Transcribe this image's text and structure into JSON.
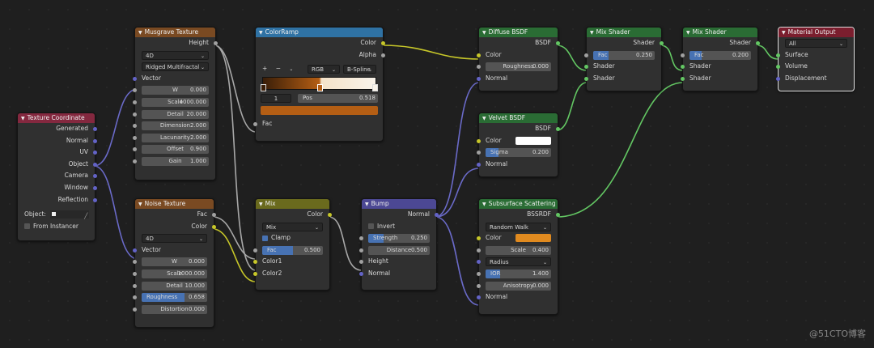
{
  "nodes": {
    "texcoord": {
      "title": "Texture Coordinate",
      "outputs": [
        "Generated",
        "Normal",
        "UV",
        "Object",
        "Camera",
        "Window",
        "Reflection"
      ],
      "object_label": "Object:",
      "from_instancer": "From Instancer"
    },
    "musgrave": {
      "title": "Musgrave Texture",
      "out_height": "Height",
      "dim": "4D",
      "type": "Ridged Multifractal",
      "in_vector": "Vector",
      "fields": [
        {
          "l": "W",
          "v": "0.000"
        },
        {
          "l": "Scale",
          "v": "4000.000"
        },
        {
          "l": "Detail",
          "v": "20.000"
        },
        {
          "l": "Dimension",
          "v": "2.000"
        },
        {
          "l": "Lacunarity",
          "v": "2.000"
        },
        {
          "l": "Offset",
          "v": "0.900"
        },
        {
          "l": "Gain",
          "v": "1.000"
        }
      ]
    },
    "noise": {
      "title": "Noise Texture",
      "out_fac": "Fac",
      "out_color": "Color",
      "dim": "4D",
      "in_vector": "Vector",
      "fields": [
        {
          "l": "W",
          "v": "0.000"
        },
        {
          "l": "Scale",
          "v": "1000.000"
        },
        {
          "l": "Detail",
          "v": "10.000"
        },
        {
          "l": "Roughness",
          "v": "0.658"
        },
        {
          "l": "Distortion",
          "v": "0.000"
        }
      ]
    },
    "colorramp": {
      "title": "ColorRamp",
      "out_color": "Color",
      "out_alpha": "Alpha",
      "plus": "+",
      "minus": "−",
      "mode": "RGB",
      "interp": "B-Spline",
      "index": "1",
      "pos_label": "Pos",
      "pos_value": "0.518",
      "in_fac": "Fac",
      "color": "#b45e14"
    },
    "mix": {
      "title": "Mix",
      "out_color": "Color",
      "blend": "Mix",
      "clamp": "Clamp",
      "fac_label": "Fac",
      "fac_value": "0.500",
      "in_c1": "Color1",
      "in_c2": "Color2"
    },
    "bump": {
      "title": "Bump",
      "out_normal": "Normal",
      "invert": "Invert",
      "strength_label": "Strength",
      "strength_value": "0.250",
      "distance_label": "Distance",
      "distance_value": "0.500",
      "in_height": "Height",
      "in_normal": "Normal"
    },
    "diffuse": {
      "title": "Diffuse BSDF",
      "out_bsdf": "BSDF",
      "in_color": "Color",
      "rough_label": "Roughness",
      "rough_value": "0.000",
      "in_normal": "Normal"
    },
    "velvet": {
      "title": "Velvet BSDF",
      "out_bsdf": "BSDF",
      "in_color": "Color",
      "sigma_label": "Sigma",
      "sigma_value": "0.200",
      "in_normal": "Normal",
      "color": "#ffffff"
    },
    "sss": {
      "title": "Subsurface Scattering",
      "out_bssrdf": "BSSRDF",
      "method": "Random Walk",
      "in_color": "Color",
      "scale_label": "Scale",
      "scale_value": "0.400",
      "radius": "Radius",
      "ior_label": "IOR",
      "ior_value": "1.400",
      "aniso_label": "Anisotropy",
      "aniso_value": "0.000",
      "in_normal": "Normal",
      "color": "#e08a1f"
    },
    "mix1": {
      "title": "Mix Shader",
      "out_shader": "Shader",
      "fac_label": "Fac",
      "fac_value": "0.250",
      "in_s1": "Shader",
      "in_s2": "Shader"
    },
    "mix2": {
      "title": "Mix Shader",
      "out_shader": "Shader",
      "fac_label": "Fac",
      "fac_value": "0.200",
      "in_s1": "Shader",
      "in_s2": "Shader"
    },
    "output": {
      "title": "Material Output",
      "target": "All",
      "in_surface": "Surface",
      "in_volume": "Volume",
      "in_disp": "Displacement"
    }
  },
  "watermark": "@51CTO博客",
  "colors": {
    "shader_socket": "#63c763",
    "color_socket": "#c7c729",
    "vector_socket": "#6363c7",
    "float_socket": "#a1a1a1"
  }
}
